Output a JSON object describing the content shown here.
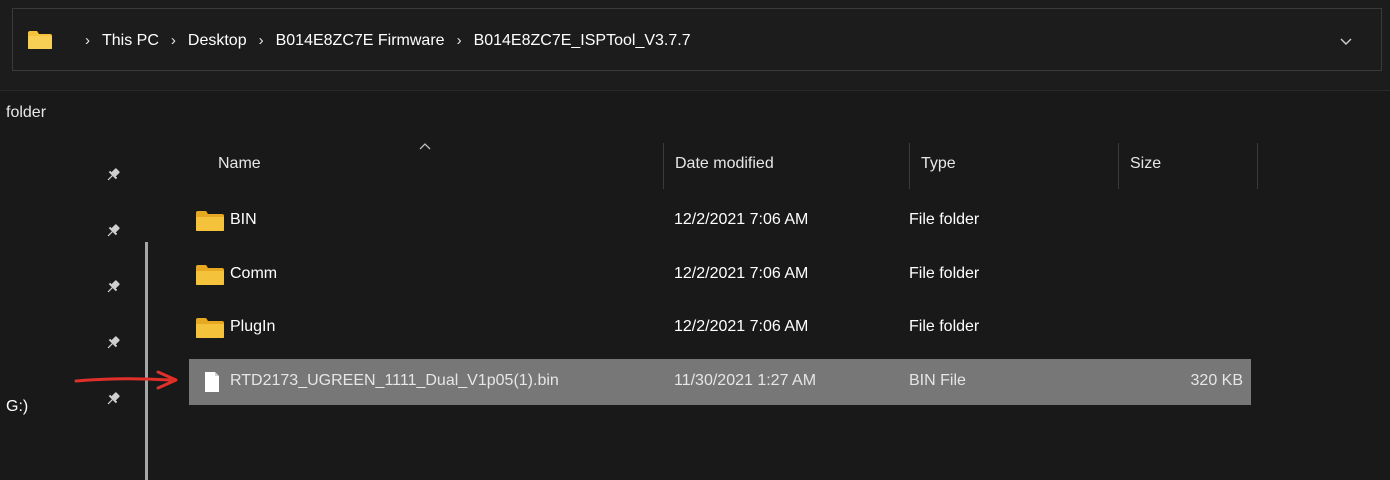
{
  "address_bar": {
    "crumbs": [
      "This PC",
      "Desktop",
      "B014E8ZC7E Firmware",
      "B014E8ZC7E_ISPTool_V3.7.7"
    ],
    "dropdown_icon": "chevron-down-icon"
  },
  "folder_label": "folder",
  "nav": {
    "drive_fragment": "G:)",
    "pin_icon": "pin-icon"
  },
  "columns": {
    "name": "Name",
    "date": "Date modified",
    "type": "Type",
    "size": "Size"
  },
  "files": [
    {
      "name": "BIN",
      "date": "12/2/2021 7:06 AM",
      "type": "File folder",
      "size": "",
      "icon": "folder-icon"
    },
    {
      "name": "Comm",
      "date": "12/2/2021 7:06 AM",
      "type": "File folder",
      "size": "",
      "icon": "folder-icon"
    },
    {
      "name": "PlugIn",
      "date": "12/2/2021 7:06 AM",
      "type": "File folder",
      "size": "",
      "icon": "folder-icon"
    },
    {
      "name": "RTD2173_UGREEN_1111_Dual_V1p05(1).bin",
      "date": "11/30/2021 1:27 AM",
      "type": "BIN File",
      "size": "320 KB",
      "icon": "file-icon",
      "selected": true
    }
  ],
  "colors": {
    "folder": "#f5c33b",
    "selection": "#777777",
    "annotation_arrow": "#e0302a",
    "background": "#191919"
  }
}
